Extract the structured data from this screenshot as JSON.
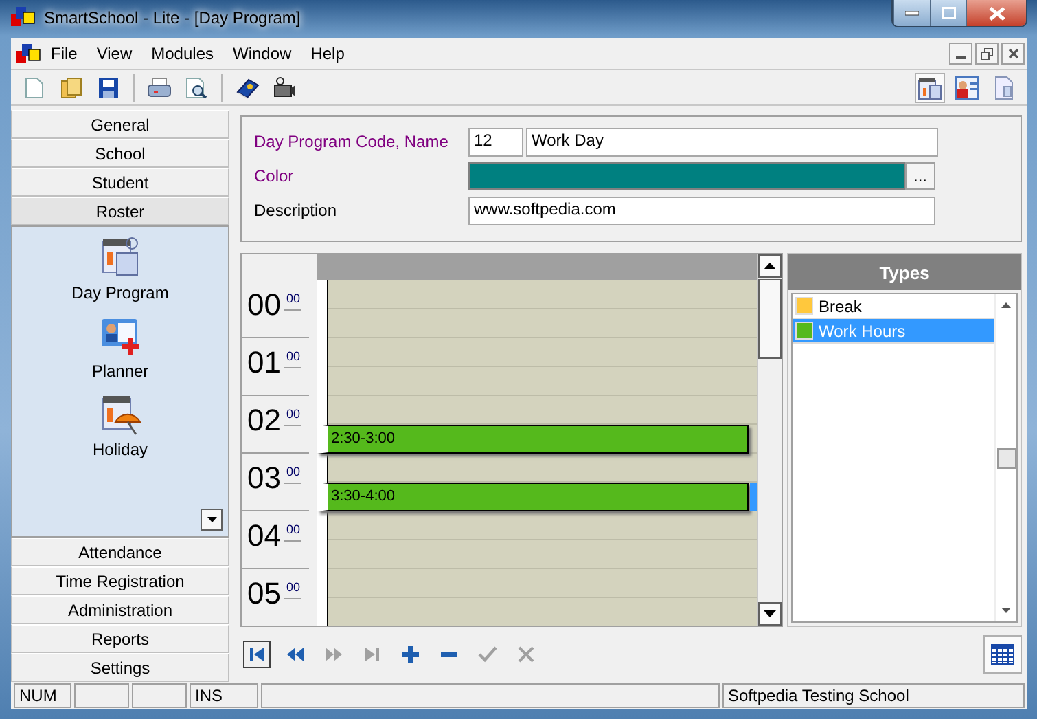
{
  "window": {
    "title": "SmartSchool - Lite - [Day Program]"
  },
  "menu": [
    "File",
    "View",
    "Modules",
    "Window",
    "Help"
  ],
  "sidebar": {
    "top_sections": [
      {
        "label": "General",
        "selected": false
      },
      {
        "label": "School",
        "selected": false
      },
      {
        "label": "Student",
        "selected": false
      },
      {
        "label": "Roster",
        "selected": true
      }
    ],
    "items": [
      {
        "label": "Day Program",
        "kind": "day-program"
      },
      {
        "label": "Planner",
        "kind": "planner"
      },
      {
        "label": "Holiday",
        "kind": "holiday"
      }
    ],
    "bottom_sections": [
      {
        "label": "Attendance",
        "selected": false
      },
      {
        "label": "Time Registration",
        "selected": false
      },
      {
        "label": "Administration",
        "selected": false
      },
      {
        "label": "Reports",
        "selected": false
      },
      {
        "label": "Settings",
        "selected": false
      }
    ]
  },
  "form": {
    "code_label": "Day Program Code, Name",
    "code": "12",
    "name": "Work Day",
    "color_label": "Color",
    "color": "#008080",
    "color_button": "...",
    "description_label": "Description",
    "description": "www.softpedia.com"
  },
  "scheduler": {
    "hours": [
      {
        "hour": "00",
        "minute": "00"
      },
      {
        "hour": "01",
        "minute": "00"
      },
      {
        "hour": "02",
        "minute": "00",
        "events": [
          {
            "label": "2:30-3:00",
            "kind": "second-half",
            "color": "#55b91c",
            "selected": false
          }
        ]
      },
      {
        "hour": "03",
        "minute": "00",
        "events": [
          {
            "label": "3:30-4:00",
            "kind": "second-half",
            "color": "#55b91c",
            "selected": true
          }
        ]
      },
      {
        "hour": "04",
        "minute": "00"
      },
      {
        "hour": "05",
        "minute": "00"
      }
    ]
  },
  "types": {
    "title": "Types",
    "items": [
      {
        "label": "Break",
        "color": "#ffc83d",
        "selected": false
      },
      {
        "label": "Work Hours",
        "color": "#55b91c",
        "selected": true
      }
    ]
  },
  "navigator": [
    {
      "kind": "first",
      "disabled": false
    },
    {
      "kind": "prior",
      "disabled": false
    },
    {
      "kind": "next",
      "disabled": true
    },
    {
      "kind": "last",
      "disabled": true
    },
    {
      "kind": "insert",
      "disabled": false
    },
    {
      "kind": "delete",
      "disabled": false
    },
    {
      "kind": "post",
      "disabled": true
    },
    {
      "kind": "cancel",
      "disabled": true
    }
  ],
  "status_bar": [
    "NUM",
    "INS",
    "Softpedia Testing School"
  ]
}
